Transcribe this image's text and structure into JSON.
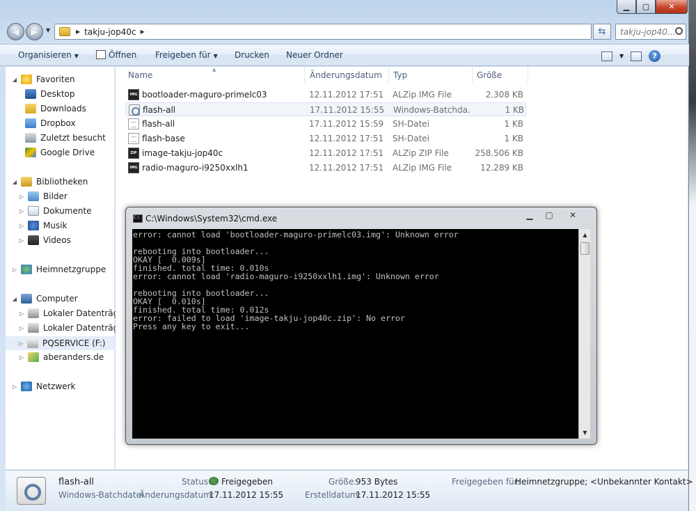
{
  "explorer": {
    "address": {
      "crumbs": [
        "takju-jop40c"
      ]
    },
    "search": {
      "placeholder": "takju-jop40..."
    },
    "caption": {
      "minimize": "▁",
      "maximize": "▢",
      "close": "✕"
    },
    "toolbar": {
      "organize": "Organisieren",
      "open": "Öffnen",
      "share": "Freigeben für",
      "print": "Drucken",
      "new_folder": "Neuer Ordner",
      "help": "?"
    },
    "nav": {
      "favorites": {
        "label": "Favoriten",
        "items": [
          "Desktop",
          "Downloads",
          "Dropbox",
          "Zuletzt besucht",
          "Google Drive"
        ]
      },
      "libraries": {
        "label": "Bibliotheken",
        "items": [
          "Bilder",
          "Dokumente",
          "Musik",
          "Videos"
        ]
      },
      "homegroup": "Heimnetzgruppe",
      "computer": {
        "label": "Computer",
        "items": [
          "Lokaler Datenträger",
          "Lokaler Datenträger",
          "PQSERVICE (F:)",
          "aberanders.de"
        ]
      },
      "network": "Netzwerk"
    },
    "columns": {
      "name": "Name",
      "date": "Änderungsdatum",
      "type": "Typ",
      "size": "Größe"
    },
    "files": [
      {
        "icon": "img-file-icon",
        "badge": "IMG",
        "name": "bootloader-maguro-primelc03",
        "date": "12.11.2012 17:51",
        "type": "ALZip IMG File",
        "size": "2.308 KB"
      },
      {
        "icon": "batch-file-icon",
        "badge": "",
        "name": "flash-all",
        "date": "17.11.2012 15:55",
        "type": "Windows-Batchda...",
        "size": "1 KB"
      },
      {
        "icon": "sh-file-icon",
        "badge": "",
        "name": "flash-all",
        "date": "17.11.2012 15:59",
        "type": "SH-Datei",
        "size": "1 KB"
      },
      {
        "icon": "sh-file-icon",
        "badge": "",
        "name": "flash-base",
        "date": "12.11.2012 17:51",
        "type": "SH-Datei",
        "size": "1 KB"
      },
      {
        "icon": "zip-file-icon",
        "badge": "ZIP",
        "name": "image-takju-jop40c",
        "date": "12.11.2012 17:51",
        "type": "ALZip ZIP File",
        "size": "258.506 KB"
      },
      {
        "icon": "img-file-icon",
        "badge": "IMG",
        "name": "radio-maguro-i9250xxlh1",
        "date": "12.11.2012 17:51",
        "type": "ALZip IMG File",
        "size": "12.289 KB"
      }
    ],
    "details": {
      "name": "flash-all",
      "type": "Windows-Batchdatei",
      "status_label": "Status:",
      "status_value": "Freigegeben",
      "modified_label": "Änderungsdatum:",
      "modified_value": "17.11.2012 15:55",
      "size_label": "Größe:",
      "size_value": "953 Bytes",
      "created_label": "Erstelldatum:",
      "created_value": "17.11.2012 15:55",
      "shared_label": "Freigegeben für:",
      "shared_value": "Heimnetzgruppe; <Unbekannter Kontakt>"
    }
  },
  "cmd": {
    "title": "C:\\Windows\\System32\\cmd.exe",
    "icon_text": "C:\\",
    "lines": [
      "error: cannot load 'bootloader-maguro-primelc03.img': Unknown error",
      "",
      "rebooting into bootloader...",
      "OKAY [  0.009s]",
      "finished. total time: 0.010s",
      "error: cannot load 'radio-maguro-i9250xxlh1.img': Unknown error",
      "",
      "rebooting into bootloader...",
      "OKAY [  0.010s]",
      "finished. total time: 0.012s",
      "error: failed to load 'image-takju-jop40c.zip': No error",
      "Press any key to exit..."
    ]
  }
}
